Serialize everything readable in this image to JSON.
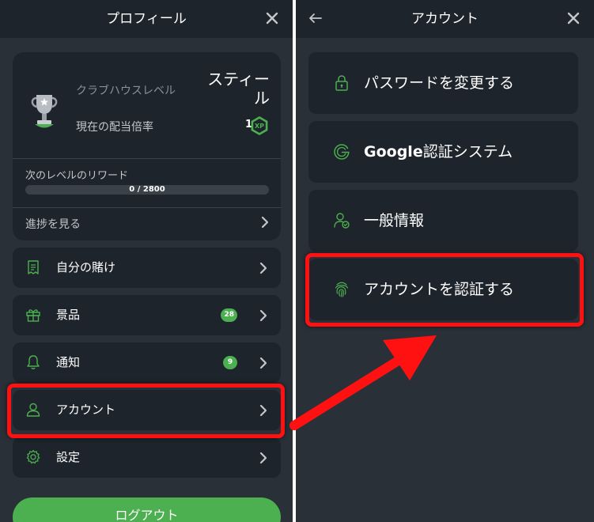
{
  "profile_panel": {
    "title": "プロフィール",
    "club_label": "クラブハウスレベル",
    "club_level": "スティール",
    "multiplier_label": "現在の配当倍率",
    "multiplier_value": "1",
    "reward_label": "次のレベルのリワード",
    "progress_text": "0 / 2800",
    "progress_fraction": 0,
    "progress_link": "進捗を見る",
    "menu": [
      {
        "label": "自分の賭け",
        "icon": "receipt-icon",
        "badge": ""
      },
      {
        "label": "景品",
        "icon": "gift-icon",
        "badge": "28"
      },
      {
        "label": "通知",
        "icon": "bell-icon",
        "badge": "9"
      },
      {
        "label": "アカウント",
        "icon": "user-icon",
        "badge": ""
      },
      {
        "label": "設定",
        "icon": "gear-icon",
        "badge": ""
      }
    ],
    "logout_label": "ログアウト"
  },
  "account_panel": {
    "title": "アカウント",
    "items": [
      {
        "label": "パスワードを変更する",
        "icon": "lock-icon"
      },
      {
        "label_bold": "Google",
        "label_rest": "認証システム",
        "icon": "google-g-icon"
      },
      {
        "label": "一般情報",
        "icon": "user-check-icon"
      },
      {
        "label": "アカウントを認証する",
        "icon": "fingerprint-icon"
      }
    ]
  },
  "colors": {
    "panel_bg": "#2a3038",
    "card_bg": "#1e242b",
    "accent_green": "#4caf50",
    "highlight_red": "#ff1111"
  }
}
